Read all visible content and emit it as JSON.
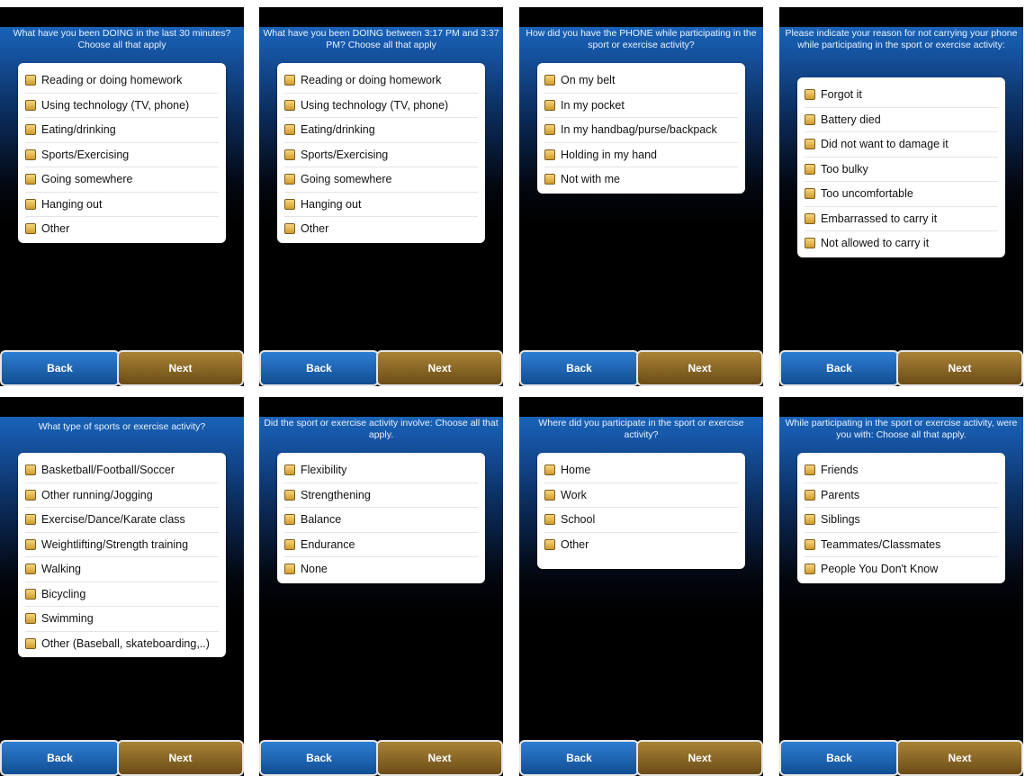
{
  "buttons": {
    "back_label": "Back",
    "next_label": "Next"
  },
  "colors": {
    "header_blue": "#1d6fc9",
    "back_button": "#1a63b3",
    "next_button": "#8a6628",
    "checkbox": "#e0b04a"
  },
  "screens": [
    {
      "question": "What have you been DOING in the last 30 minutes? Choose all that apply",
      "options": [
        "Reading or doing homework",
        "Using technology (TV, phone)",
        "Eating/drinking",
        "Sports/Exercising",
        "Going somewhere",
        "Hanging out",
        "Other"
      ]
    },
    {
      "question": "What have you been DOING between 3:17 PM and 3:37 PM? Choose all that apply",
      "options": [
        "Reading or doing homework",
        "Using technology (TV, phone)",
        "Eating/drinking",
        "Sports/Exercising",
        "Going somewhere",
        "Hanging out",
        "Other"
      ]
    },
    {
      "question": "How did you have the PHONE while participating in the sport or exercise activity?",
      "options": [
        "On my belt",
        "In my pocket",
        "In my handbag/purse/backpack",
        "Holding in my hand",
        "Not with me"
      ]
    },
    {
      "question": "Please indicate your reason for not carrying your phone while participating in the sport or exercise activity:",
      "options": [
        "Forgot it",
        "Battery died",
        "Did not want to damage it",
        "Too bulky",
        "Too uncomfortable",
        "Embarrassed to carry it",
        "Not allowed to carry it"
      ]
    },
    {
      "question": "What type of sports or exercise activity?",
      "options": [
        "Basketball/Football/Soccer",
        "Other running/Jogging",
        "Exercise/Dance/Karate class",
        "Weightlifting/Strength training",
        "Walking",
        "Bicycling",
        "Swimming",
        "Other (Baseball, skateboarding,..)"
      ]
    },
    {
      "question": "Did the sport or exercise activity involve: Choose all that apply.",
      "options": [
        "Flexibility",
        "Strengthening",
        "Balance",
        "Endurance",
        "None"
      ]
    },
    {
      "question": "Where did you participate in the sport or exercise activity?",
      "options": [
        "Home",
        "Work",
        "School",
        "Other"
      ]
    },
    {
      "question": "While participating in the sport or exercise activity, were you with: Choose all that apply.",
      "options": [
        "Friends",
        "Parents",
        "Siblings",
        "Teammates/Classmates",
        "People You Don't Know"
      ]
    }
  ]
}
